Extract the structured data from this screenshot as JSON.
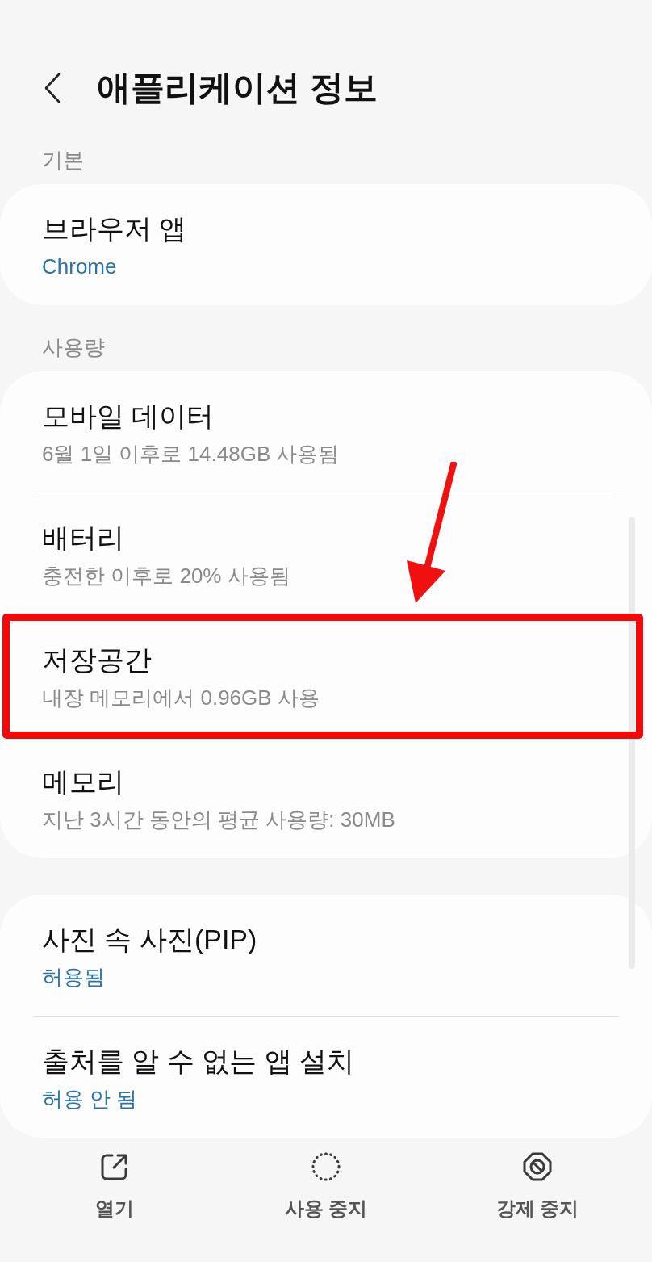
{
  "header": {
    "title": "애플리케이션 정보"
  },
  "sections": [
    {
      "label": "기본",
      "items": [
        {
          "title": "브라우저 앱",
          "subtitle": "Chrome",
          "kind": "value",
          "highlighted": false
        }
      ]
    },
    {
      "label": "사용량",
      "items": [
        {
          "title": "모바일 데이터",
          "subtitle": "6월 1일 이후로 14.48GB 사용됨",
          "kind": "summary",
          "highlighted": false
        },
        {
          "title": "배터리",
          "subtitle": "충전한 이후로 20% 사용됨",
          "kind": "summary",
          "highlighted": false
        },
        {
          "title": "저장공간",
          "subtitle": "내장 메모리에서 0.96GB 사용",
          "kind": "summary",
          "highlighted": true
        },
        {
          "title": "메모리",
          "subtitle": "지난 3시간 동안의 평균 사용량: 30MB",
          "kind": "summary",
          "highlighted": false
        }
      ]
    },
    {
      "items": [
        {
          "title": "사진 속 사진(PIP)",
          "subtitle": "허용됨",
          "kind": "value",
          "highlighted": false
        },
        {
          "title": "출처를 알 수 없는 앱 설치",
          "subtitle": "허용 안 됨",
          "kind": "value",
          "highlighted": false
        }
      ]
    }
  ],
  "actions": [
    {
      "label": "열기",
      "kind": "open"
    },
    {
      "label": "사용 중지",
      "kind": "disable"
    },
    {
      "label": "강제 중지",
      "kind": "force-stop"
    }
  ]
}
